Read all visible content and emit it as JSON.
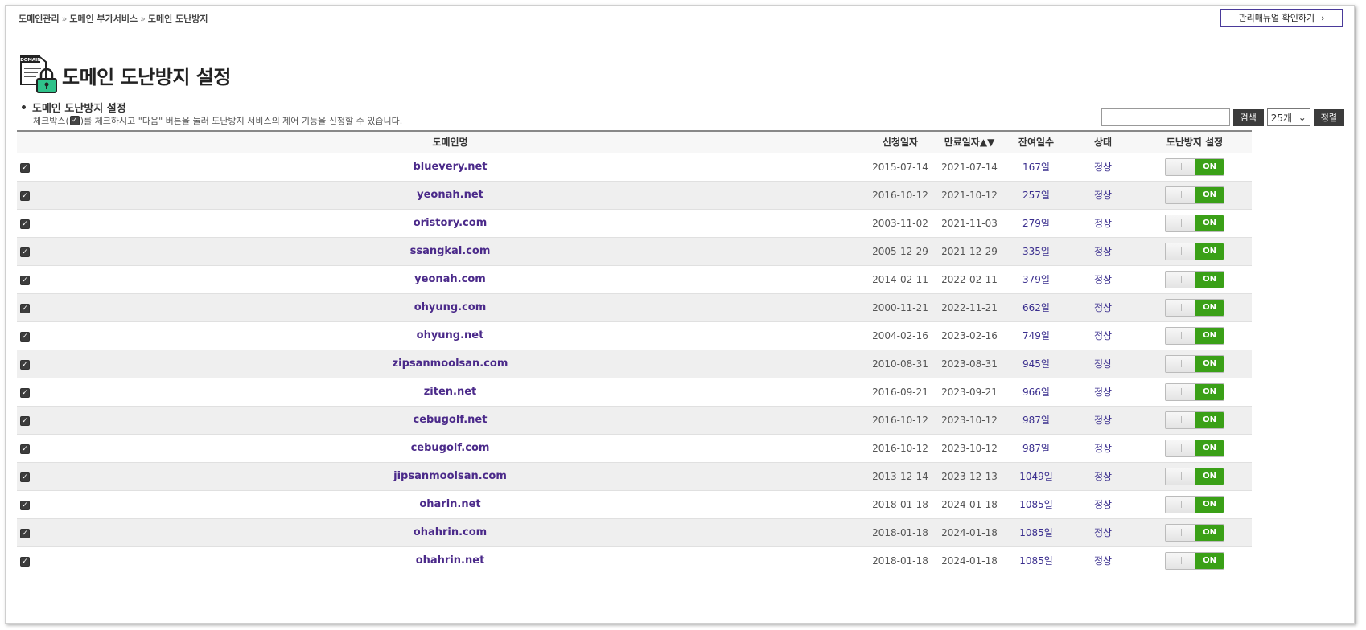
{
  "breadcrumb": {
    "items": [
      "도메인관리",
      "도메인 부가서비스",
      "도메인 도난방지"
    ],
    "separator": "»"
  },
  "manual_button": {
    "label": "관리매뉴얼 확인하기",
    "chevron": "›"
  },
  "page": {
    "title": "도메인 도난방지 설정",
    "icon": "domain-lock-icon",
    "icon_text": "DOMAIN"
  },
  "section": {
    "heading": "도메인 도난방지 설정",
    "desc_before": "체크박스(",
    "desc_after": ")를 체크하시고 \"다음\" 버튼을 눌러 도난방지 서비스의 제어 기능을 신청할 수 있습니다."
  },
  "toolbar": {
    "search_value": "",
    "search_button": "검색",
    "per_page": "25개",
    "sort_button": "정렬"
  },
  "table": {
    "headers": {
      "domain": "도메인명",
      "applied": "신청일자",
      "expires": "만료일자▲▼",
      "remaining": "잔여일수",
      "status": "상태",
      "theft": "도난방지 설정"
    },
    "toggle_label": "ON",
    "colors": {
      "domain": "#4b2a8a",
      "toggle_on": "#3aa017"
    },
    "rows": [
      {
        "domain": "bluevery.net",
        "applied": "2015-07-14",
        "expires": "2021-07-14",
        "remaining": "167일",
        "status": "정상"
      },
      {
        "domain": "yeonah.net",
        "applied": "2016-10-12",
        "expires": "2021-10-12",
        "remaining": "257일",
        "status": "정상"
      },
      {
        "domain": "oristory.com",
        "applied": "2003-11-02",
        "expires": "2021-11-03",
        "remaining": "279일",
        "status": "정상"
      },
      {
        "domain": "ssangkal.com",
        "applied": "2005-12-29",
        "expires": "2021-12-29",
        "remaining": "335일",
        "status": "정상"
      },
      {
        "domain": "yeonah.com",
        "applied": "2014-02-11",
        "expires": "2022-02-11",
        "remaining": "379일",
        "status": "정상"
      },
      {
        "domain": "ohyung.com",
        "applied": "2000-11-21",
        "expires": "2022-11-21",
        "remaining": "662일",
        "status": "정상"
      },
      {
        "domain": "ohyung.net",
        "applied": "2004-02-16",
        "expires": "2023-02-16",
        "remaining": "749일",
        "status": "정상"
      },
      {
        "domain": "zipsanmoolsan.com",
        "applied": "2010-08-31",
        "expires": "2023-08-31",
        "remaining": "945일",
        "status": "정상"
      },
      {
        "domain": "ziten.net",
        "applied": "2016-09-21",
        "expires": "2023-09-21",
        "remaining": "966일",
        "status": "정상"
      },
      {
        "domain": "cebugolf.net",
        "applied": "2016-10-12",
        "expires": "2023-10-12",
        "remaining": "987일",
        "status": "정상"
      },
      {
        "domain": "cebugolf.com",
        "applied": "2016-10-12",
        "expires": "2023-10-12",
        "remaining": "987일",
        "status": "정상"
      },
      {
        "domain": "jipsanmoolsan.com",
        "applied": "2013-12-14",
        "expires": "2023-12-13",
        "remaining": "1049일",
        "status": "정상"
      },
      {
        "domain": "oharin.net",
        "applied": "2018-01-18",
        "expires": "2024-01-18",
        "remaining": "1085일",
        "status": "정상"
      },
      {
        "domain": "ohahrin.com",
        "applied": "2018-01-18",
        "expires": "2024-01-18",
        "remaining": "1085일",
        "status": "정상"
      },
      {
        "domain": "ohahrin.net",
        "applied": "2018-01-18",
        "expires": "2024-01-18",
        "remaining": "1085일",
        "status": "정상"
      }
    ]
  }
}
